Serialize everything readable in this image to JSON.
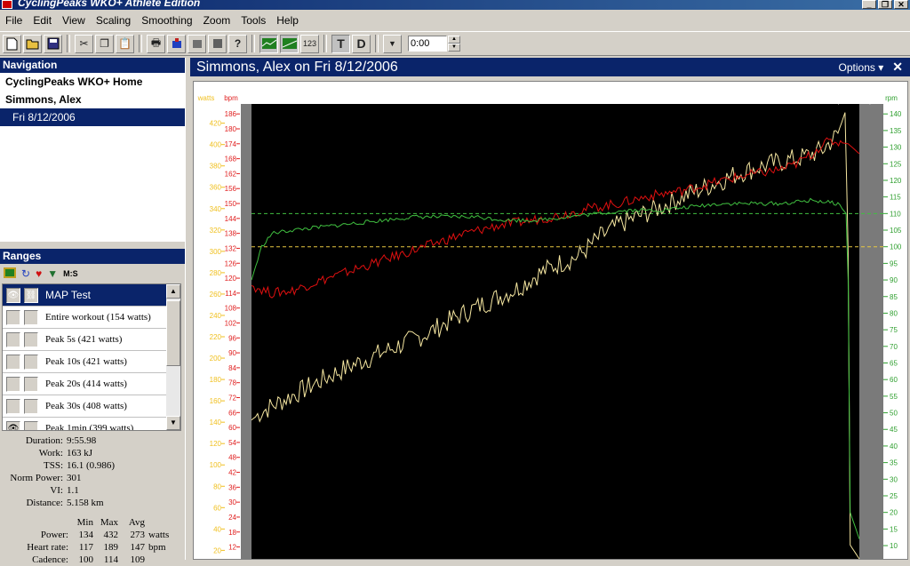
{
  "window": {
    "title": "CyclingPeaks WKO+ Athlete Edition",
    "min": "_",
    "max": "❐",
    "close": "✕"
  },
  "menu": [
    "File",
    "Edit",
    "View",
    "Scaling",
    "Smoothing",
    "Zoom",
    "Tools",
    "Help"
  ],
  "toolbar": {
    "time_value": "0:00",
    "text_button": "T",
    "dist_button": "D",
    "units_button": "123"
  },
  "navigation": {
    "header": "Navigation",
    "items": [
      {
        "label": "CyclingPeaks WKO+ Home"
      },
      {
        "label": "Simmons, Alex"
      },
      {
        "label": "Fri 8/12/2006",
        "selected": true
      }
    ]
  },
  "ranges": {
    "header": "Ranges",
    "toolbar_ms_label": "M:S",
    "list": [
      {
        "label": "MAP Test",
        "eye": true,
        "header": true
      },
      {
        "label": "Entire workout (154 watts)",
        "eye": false
      },
      {
        "label": "Peak 5s (421 watts)",
        "eye": false
      },
      {
        "label": "Peak 10s (421 watts)",
        "eye": false
      },
      {
        "label": "Peak 20s (414 watts)",
        "eye": false
      },
      {
        "label": "Peak 30s (408 watts)",
        "eye": false
      },
      {
        "label": "Peak 1min (399 watts)",
        "eye": true
      }
    ]
  },
  "stats": [
    {
      "label": "Duration:",
      "value": "9:55.98"
    },
    {
      "label": "Work:",
      "value": "163 kJ"
    },
    {
      "label": "TSS:",
      "value": "16.1 (0.986)"
    },
    {
      "label": "Norm Power:",
      "value": "301"
    },
    {
      "label": "VI:",
      "value": "1.1"
    },
    {
      "label": "Distance:",
      "value": "5.158 km"
    }
  ],
  "minmax": {
    "headers": [
      "Min",
      "Max",
      "Avg"
    ],
    "rows": [
      {
        "label": "Power:",
        "min": "134",
        "max": "432",
        "avg": "273",
        "unit": "watts"
      },
      {
        "label": "Heart rate:",
        "min": "117",
        "max": "189",
        "avg": "147",
        "unit": "bpm"
      },
      {
        "label": "Cadence:",
        "min": "100",
        "max": "114",
        "avg": "109",
        "unit": ""
      }
    ]
  },
  "workout": {
    "title": "Simmons, Alex on Fri 8/12/2006",
    "options_label": "Options ▾",
    "close_label": "✕"
  },
  "colors": {
    "power": "#f5e6a0",
    "heart_rate": "#e01010",
    "cadence": "#40c040",
    "axis_watts": "#f0c020",
    "axis_bpm": "#e02020",
    "axis_rpm": "#30a030"
  },
  "chart_data": {
    "type": "line",
    "range_label_left": "MAP Test",
    "range_label_right": "Peak 1min (399 watts)",
    "left_axis_unit": "watts",
    "hr_axis_unit": "bpm",
    "right_axis_unit": "rpm",
    "watts_ticks": [
      20,
      40,
      60,
      80,
      100,
      120,
      140,
      160,
      180,
      200,
      220,
      240,
      260,
      280,
      300,
      320,
      340,
      360,
      380,
      400,
      420
    ],
    "watts_ylim": [
      12,
      438
    ],
    "bpm_ticks": [
      12,
      18,
      24,
      30,
      36,
      42,
      48,
      54,
      60,
      66,
      72,
      78,
      84,
      90,
      96,
      102,
      108,
      114,
      120,
      126,
      132,
      138,
      144,
      150,
      156,
      162,
      168,
      174,
      180,
      186
    ],
    "bpm_ylim": [
      7.2,
      190
    ],
    "rpm_ticks": [
      10,
      15,
      20,
      25,
      30,
      35,
      40,
      45,
      50,
      55,
      60,
      65,
      70,
      75,
      80,
      85,
      90,
      95,
      100,
      105,
      110,
      115,
      120,
      125,
      130,
      135,
      140
    ],
    "rpm_ylim": [
      6,
      143
    ],
    "x_range": [
      0,
      596
    ],
    "reference_lines": [
      {
        "axis": "rpm",
        "value": 110,
        "color": "#40c040"
      },
      {
        "axis": "rpm",
        "value": 100,
        "color": "#e8c840"
      }
    ],
    "series": [
      {
        "name": "Power",
        "axis": "watts",
        "points": [
          [
            0,
            142
          ],
          [
            10,
            150
          ],
          [
            30,
            160
          ],
          [
            50,
            170
          ],
          [
            80,
            185
          ],
          [
            110,
            198
          ],
          [
            140,
            210
          ],
          [
            170,
            222
          ],
          [
            200,
            238
          ],
          [
            230,
            252
          ],
          [
            260,
            265
          ],
          [
            280,
            278
          ],
          [
            300,
            288
          ],
          [
            320,
            295
          ],
          [
            340,
            312
          ],
          [
            360,
            325
          ],
          [
            380,
            333
          ],
          [
            400,
            341
          ],
          [
            420,
            350
          ],
          [
            450,
            362
          ],
          [
            480,
            374
          ],
          [
            510,
            382
          ],
          [
            540,
            388
          ],
          [
            560,
            395
          ],
          [
            575,
            410
          ],
          [
            582,
            430
          ],
          [
            585,
            300
          ],
          [
            587,
            25
          ],
          [
            596,
            12
          ]
        ]
      },
      {
        "name": "Heart Rate",
        "axis": "bpm",
        "points": [
          [
            0,
            117
          ],
          [
            20,
            114
          ],
          [
            40,
            115
          ],
          [
            60,
            118
          ],
          [
            90,
            122
          ],
          [
            120,
            126
          ],
          [
            150,
            130
          ],
          [
            180,
            134
          ],
          [
            210,
            138
          ],
          [
            240,
            141
          ],
          [
            270,
            143
          ],
          [
            300,
            145
          ],
          [
            330,
            148
          ],
          [
            360,
            150
          ],
          [
            390,
            153
          ],
          [
            420,
            155
          ],
          [
            450,
            158
          ],
          [
            480,
            161
          ],
          [
            510,
            163
          ],
          [
            530,
            165
          ],
          [
            550,
            170
          ],
          [
            560,
            174
          ],
          [
            570,
            175
          ],
          [
            585,
            174
          ],
          [
            596,
            170
          ]
        ]
      },
      {
        "name": "Cadence",
        "axis": "rpm",
        "points": [
          [
            0,
            90
          ],
          [
            10,
            100
          ],
          [
            20,
            104
          ],
          [
            40,
            105
          ],
          [
            70,
            106
          ],
          [
            100,
            107
          ],
          [
            130,
            108
          ],
          [
            160,
            109
          ],
          [
            190,
            109
          ],
          [
            220,
            109
          ],
          [
            250,
            108
          ],
          [
            280,
            108
          ],
          [
            310,
            109
          ],
          [
            340,
            110
          ],
          [
            370,
            111
          ],
          [
            400,
            111
          ],
          [
            430,
            112
          ],
          [
            460,
            113
          ],
          [
            490,
            113
          ],
          [
            520,
            113
          ],
          [
            550,
            114
          ],
          [
            575,
            113
          ],
          [
            583,
            110
          ],
          [
            585,
            90
          ],
          [
            587,
            20
          ],
          [
            596,
            12
          ]
        ]
      }
    ]
  }
}
